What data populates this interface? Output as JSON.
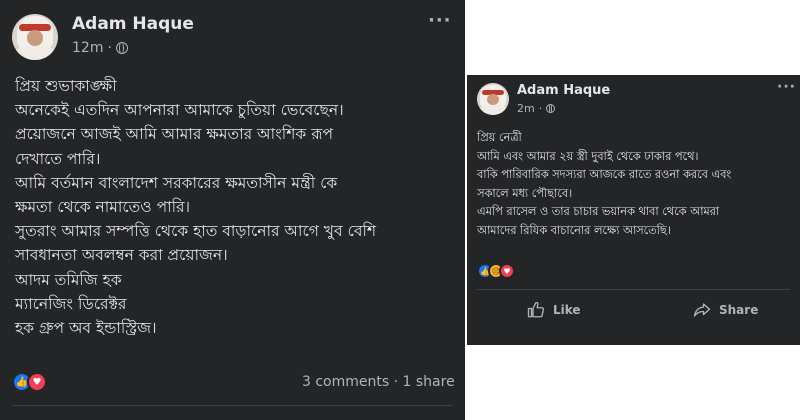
{
  "left_post": {
    "author": "Adam Haque",
    "time": "12m",
    "separator": "·",
    "more": "···",
    "lines": [
      "প্রিয় শুভাকাঙ্ক্ষী",
      "অনেকেই এতদিন আপনারা আমাকে চুতিয়া ভেবেছেন।",
      "প্রয়োজনে আজই আমি আমার ক্ষমতার আংশিক রূপ",
      "দেখাতে পারি।",
      "আমি বর্তমান বাংলাদেশ সরকারের ক্ষমতাসীন মন্ত্রী কে",
      "ক্ষমতা থেকে নামাতেও পারি।",
      "সুতরাং আমার সম্পত্তি থেকে হাত বাড়ানোর আগে খুব বেশি",
      "সাবধানতা অবলম্বন করা প্রয়োজন।",
      "আদম তমিজি হক",
      "ম্যানেজিং ডিরেক্টর",
      "হক গ্রুপ অব ইন্ডাস্ট্রিজ।"
    ],
    "stats": "3 comments · 1 share",
    "reactions": [
      "like-reaction-icon",
      "love-reaction-icon"
    ]
  },
  "right_post": {
    "author": "Adam Haque",
    "time": "2m",
    "separator": "·",
    "more": "···",
    "lines": [
      "প্রিয় নেত্রী",
      "আমি এবং আমার ২য় স্ত্রী দুবাই থেকে ঢাকার পথে।",
      "বাকি পারিবারিক সদস্যরা আজকে রাতে রওনা করবে এবং",
      "সকালে মধ্য পৌছাবে।",
      "এমপি রাসেল ও তার চাচার ভয়ানক থাবা থেকে আমরা",
      "আমাদের রিযিক বাচানোর লক্ষ্যে আসতেছি।"
    ],
    "reactions": [
      "like-reaction-icon",
      "sad-reaction-icon",
      "love-reaction-icon"
    ],
    "like_label": "Like",
    "share_label": "Share"
  },
  "colors": {
    "post_bg": "#242526",
    "text": "#e4e6eb",
    "secondary": "#b0b3b8",
    "like_blue": "#1877f2",
    "love_red": "#f33e58",
    "sad_yellow": "#f7b125"
  }
}
